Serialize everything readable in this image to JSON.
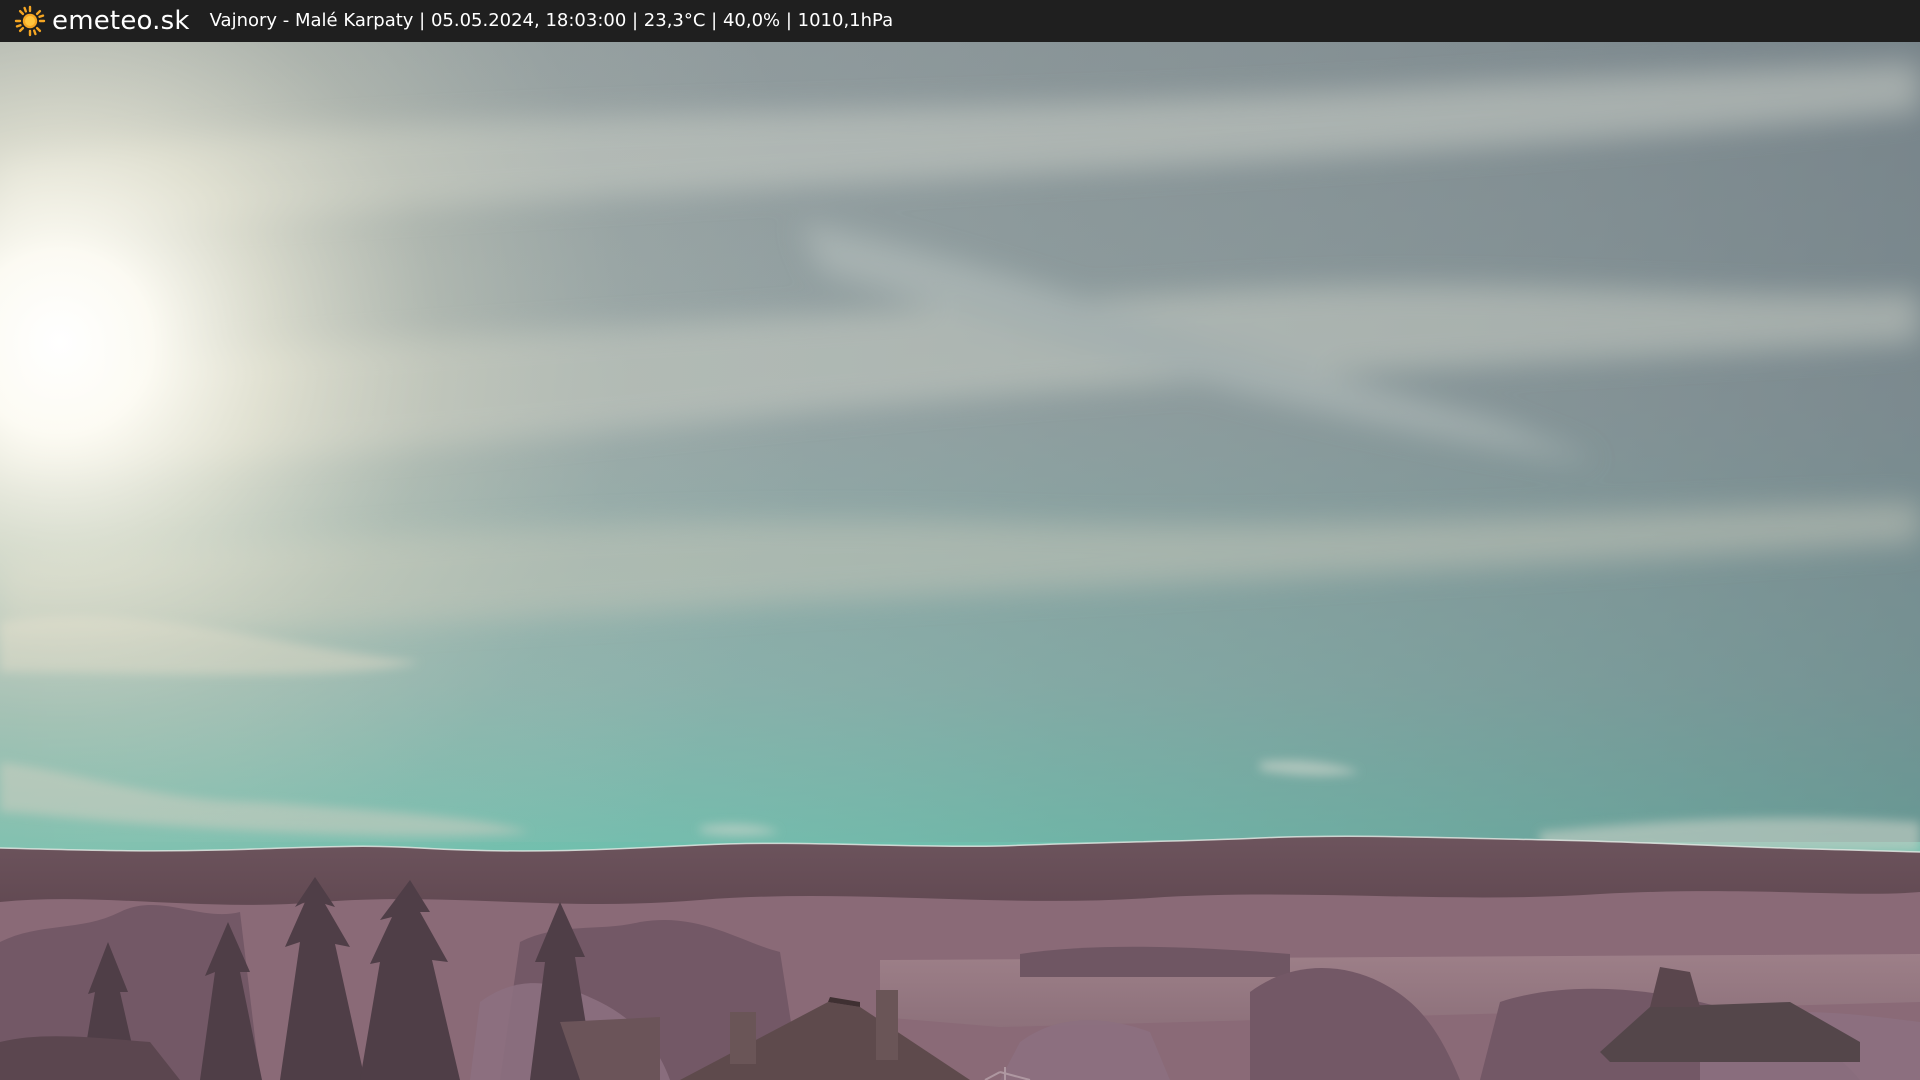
{
  "header": {
    "brand": "emeteo.sk",
    "caption": "Vajnory - Malé Karpaty | 05.05.2024, 18:03:00 | 23,3°C | 40,0% | 1010,1hPa",
    "logo_icon": "sun-icon"
  },
  "colors": {
    "bar_background": "#1f1f1f",
    "sun": "#f5a623",
    "sky_top": "#8d989a",
    "sky_horizon": "#72bfae",
    "hills": "#6a5058",
    "foliage": "#9a7a86"
  }
}
